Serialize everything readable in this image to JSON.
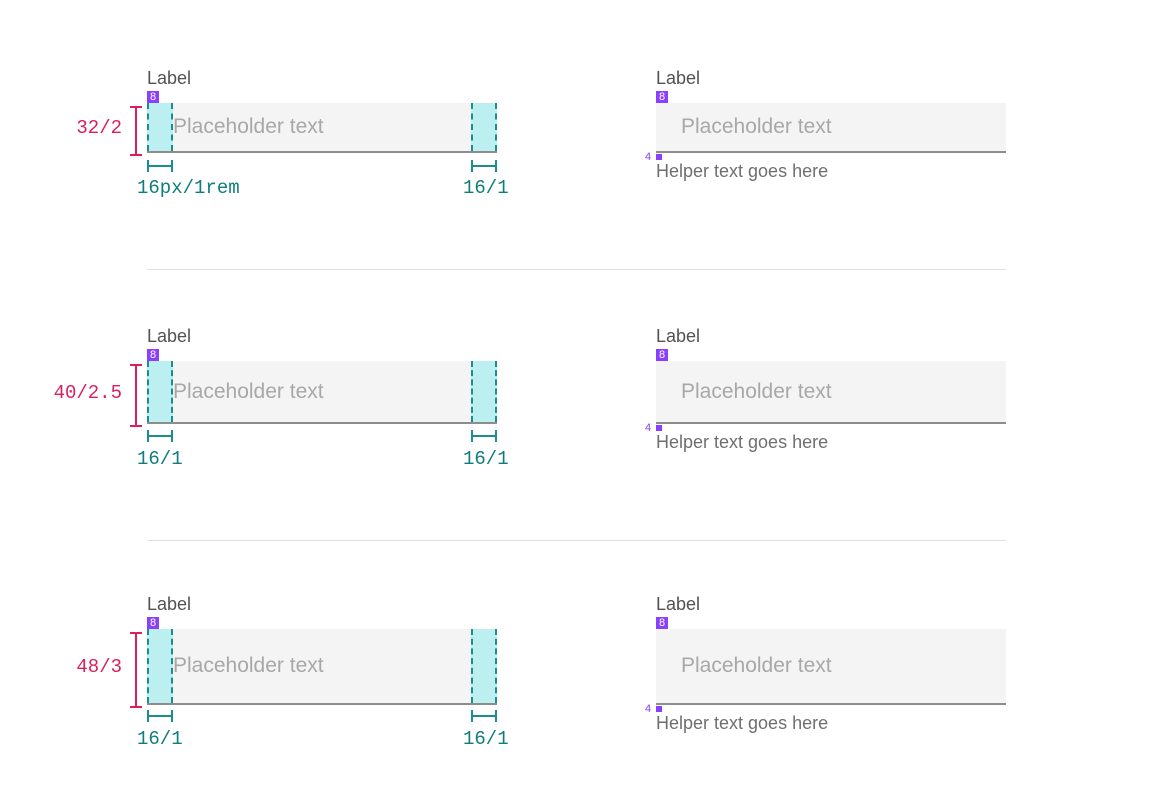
{
  "rows": [
    {
      "size_label": "32/2",
      "left_padding_label": "16px/1rem",
      "right_padding_label": "16/1"
    },
    {
      "size_label": "40/2.5",
      "left_padding_label": "16/1",
      "right_padding_label": "16/1"
    },
    {
      "size_label": "48/3",
      "left_padding_label": "16/1",
      "right_padding_label": "16/1"
    }
  ],
  "field": {
    "label": "Label",
    "placeholder": "Placeholder text",
    "helper": "Helper text goes here"
  },
  "spacing": {
    "label_gap": "8",
    "helper_gap": "4"
  },
  "colors": {
    "spacing_badge": "#8a3ffc",
    "height_dimension": "#da1e5e",
    "padding_dimension": "#0f7d7d",
    "padding_fill": "#bbeff0"
  }
}
